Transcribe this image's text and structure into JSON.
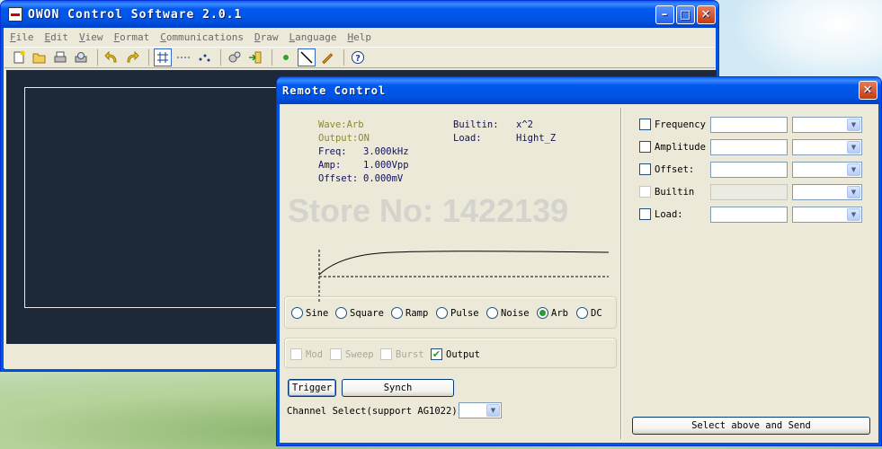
{
  "main_window": {
    "title": "OWON Control Software 2.0.1",
    "menu": [
      "File",
      "Edit",
      "View",
      "Format",
      "Communications",
      "Draw",
      "Language",
      "Help"
    ],
    "toolbar_icons": [
      "new-file-icon",
      "open-folder-icon",
      "print-icon",
      "print-preview-icon",
      "undo-icon",
      "redo-icon",
      "grid-icon",
      "dotted-line-icon",
      "points-icon",
      "settings-gears-icon",
      "import-icon",
      "point-icon",
      "line-tool-icon",
      "pen-icon",
      "help-icon"
    ],
    "controls": {
      "minimize": "–",
      "maximize": "□",
      "close": "✕"
    }
  },
  "remote_control": {
    "title": "Remote Control",
    "close": "✕",
    "info": {
      "wave": "Wave:Arb",
      "output": "Output:ON",
      "freq_label": "Freq:",
      "freq_value": "3.000kHz",
      "amp_label": "Amp:",
      "amp_value": "1.000Vpp",
      "offset_label": "Offset:",
      "offset_value": "0.000mV",
      "builtin_label": "Builtin:",
      "builtin_value": "x^2",
      "load_label": "Load:",
      "load_value": "Hight_Z"
    },
    "watermark": "Store No: 1422139",
    "waveforms": [
      {
        "label": "Sine",
        "selected": false
      },
      {
        "label": "Square",
        "selected": false
      },
      {
        "label": "Ramp",
        "selected": false
      },
      {
        "label": "Pulse",
        "selected": false
      },
      {
        "label": "Noise",
        "selected": false
      },
      {
        "label": "Arb",
        "selected": true
      },
      {
        "label": "DC",
        "selected": false
      }
    ],
    "modes": [
      {
        "label": "Mod",
        "checked": false,
        "enabled": false
      },
      {
        "label": "Sweep",
        "checked": false,
        "enabled": false
      },
      {
        "label": "Burst",
        "checked": false,
        "enabled": false
      },
      {
        "label": "Output",
        "checked": true,
        "enabled": true
      }
    ],
    "trigger_button": "Trigger",
    "synch_button": "Synch",
    "channel_label": "Channel Select(support AG1022):",
    "channel_value": "",
    "params": [
      {
        "label": "Frequency",
        "checked": false,
        "enabled": true,
        "value": "",
        "unit": ""
      },
      {
        "label": "Amplitude",
        "checked": false,
        "enabled": true,
        "value": "",
        "unit": ""
      },
      {
        "label": "Offset:",
        "checked": false,
        "enabled": true,
        "value": "",
        "unit": ""
      },
      {
        "label": "Builtin",
        "checked": false,
        "enabled": false,
        "value": "",
        "unit": ""
      },
      {
        "label": "Load:",
        "checked": false,
        "enabled": true,
        "value": "",
        "unit": ""
      }
    ],
    "send_button": "Select above and Send"
  }
}
